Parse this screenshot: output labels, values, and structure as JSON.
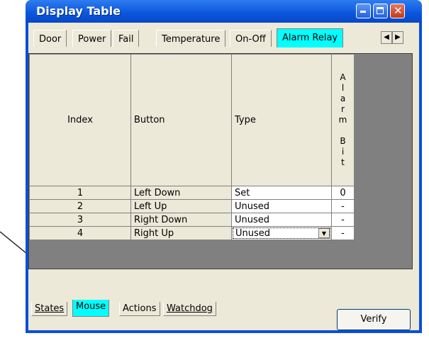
{
  "window": {
    "title": "Display Table"
  },
  "top_tabs": [
    "Door",
    "Power",
    "Fail",
    "Temperature",
    "On-Off",
    "Alarm Relay"
  ],
  "active_top_tab": "Alarm Relay",
  "table": {
    "headers": [
      "Index",
      "Button",
      "Type",
      "A\nl\na\nr\nm\n\nB\ni\nt"
    ],
    "rows": [
      [
        "1",
        "Left Down",
        "Set",
        "0"
      ],
      [
        "2",
        "Left Up",
        "Unused",
        "-"
      ],
      [
        "3",
        "Right Down",
        "Unused",
        "-"
      ],
      [
        "4",
        "Right Up",
        "Unused",
        "-"
      ]
    ]
  },
  "bottom_tabs": [
    "States",
    "Mouse",
    "Actions",
    "Watchdog"
  ],
  "active_bottom_tab": "Mouse",
  "verify_label": "Verify",
  "colors": {
    "active_tab": "#00ffff",
    "title_bar": "#0a55dd"
  }
}
